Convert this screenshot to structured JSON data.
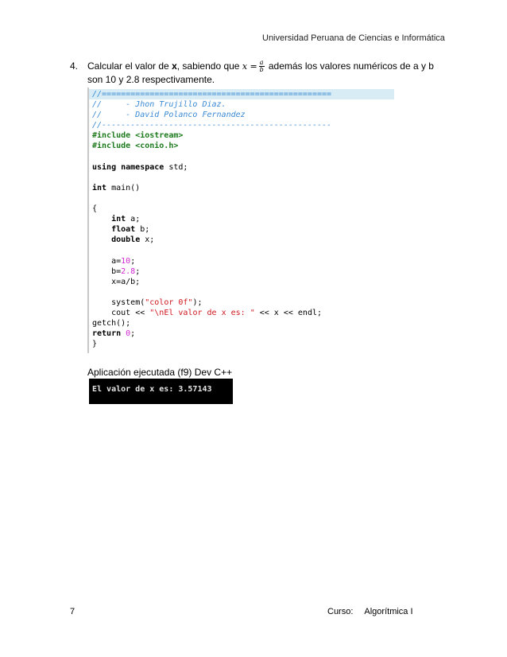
{
  "header": {
    "university": "Universidad Peruana de Ciencias e Informática"
  },
  "question": {
    "number": "4.",
    "text_before": "Calcular el valor de ",
    "variable": "x",
    "text_middle": ", sabiendo que ",
    "formula_lhs": "x =",
    "formula_num": "a",
    "formula_den": "b",
    "text_after": " además los valores numéricos de a y b son 10 y 2.8 respectivamente."
  },
  "code": {
    "lines": [
      {
        "type": "comment-hl",
        "text": "//================================================"
      },
      {
        "type": "comment",
        "text": "//     - Jhon Trujillo Diaz."
      },
      {
        "type": "comment",
        "text": "//     - David Polanco Fernandez"
      },
      {
        "type": "comment",
        "text": "//------------------------------------------------"
      },
      {
        "type": "pp",
        "text": "#include <iostream>"
      },
      {
        "type": "pp",
        "text": "#include <conio.h>"
      },
      {
        "type": "blank",
        "text": ""
      },
      {
        "type": "kwline",
        "kw": "using namespace",
        "rest": " std;"
      },
      {
        "type": "blank",
        "text": ""
      },
      {
        "type": "kwline",
        "kw": "int",
        "rest": " main()"
      },
      {
        "type": "blank",
        "text": ""
      },
      {
        "type": "plain",
        "text": "{"
      },
      {
        "type": "kwline",
        "indent": "    ",
        "kw": "int",
        "rest": " a;"
      },
      {
        "type": "kwline",
        "indent": "    ",
        "kw": "float",
        "rest": " b;"
      },
      {
        "type": "kwline",
        "indent": "    ",
        "kw": "double",
        "rest": " x;"
      },
      {
        "type": "blank",
        "text": ""
      },
      {
        "type": "assign",
        "indent": "    ",
        "lhs": "a=",
        "num": "10",
        "end": ";"
      },
      {
        "type": "assign",
        "indent": "    ",
        "lhs": "b=",
        "num": "2.8",
        "end": ";"
      },
      {
        "type": "plain",
        "text": "    x=a/b;"
      },
      {
        "type": "blank",
        "text": ""
      },
      {
        "type": "strline",
        "indent": "    ",
        "pre": "system(",
        "str": "\"color 0f\"",
        "post": ");"
      },
      {
        "type": "strline",
        "indent": "    ",
        "pre": "cout << ",
        "str": "\"\\nEl valor de x es: \"",
        "post": " << x << endl;"
      },
      {
        "type": "plain",
        "text": "getch();"
      },
      {
        "type": "retline",
        "kw": "return",
        "num": " 0",
        "end": ";"
      },
      {
        "type": "plain",
        "text": "}"
      }
    ]
  },
  "caption": "Aplicación ejecutada (f9) Dev C++",
  "console_output": "El valor de x es: 3.57143",
  "footer": {
    "page": "7",
    "course_label": "Curso:",
    "course_name": "Algorítmica I"
  }
}
